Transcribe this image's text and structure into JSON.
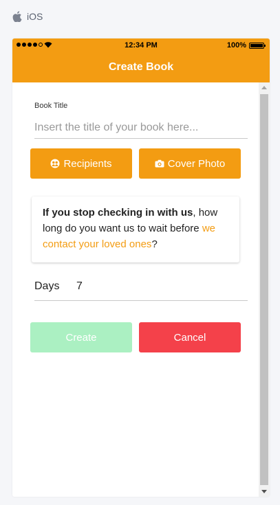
{
  "platform": {
    "label": "iOS",
    "icon": "apple-icon"
  },
  "status_bar": {
    "time": "12:34 PM",
    "battery": "100%"
  },
  "header": {
    "title": "Create Book"
  },
  "form": {
    "book_title_label": "Book Title",
    "book_title_placeholder": "Insert the title of your book here...",
    "book_title_value": "",
    "recipients_label": "Recipients",
    "recipients_icon": "group-icon",
    "cover_photo_label": "Cover Photo",
    "cover_photo_icon": "camera-icon",
    "card": {
      "strong": "If you stop checking in with us",
      "middle": ", how long do you want us to wait before ",
      "highlight": "we contact your loved ones",
      "end": "?"
    },
    "days_label": "Days",
    "days_value": "7",
    "create_label": "Create",
    "cancel_label": "Cancel"
  },
  "colors": {
    "accent": "#f39c12",
    "create_disabled": "#abf0c2",
    "cancel": "#f4414a",
    "background": "#f5f6f9"
  }
}
